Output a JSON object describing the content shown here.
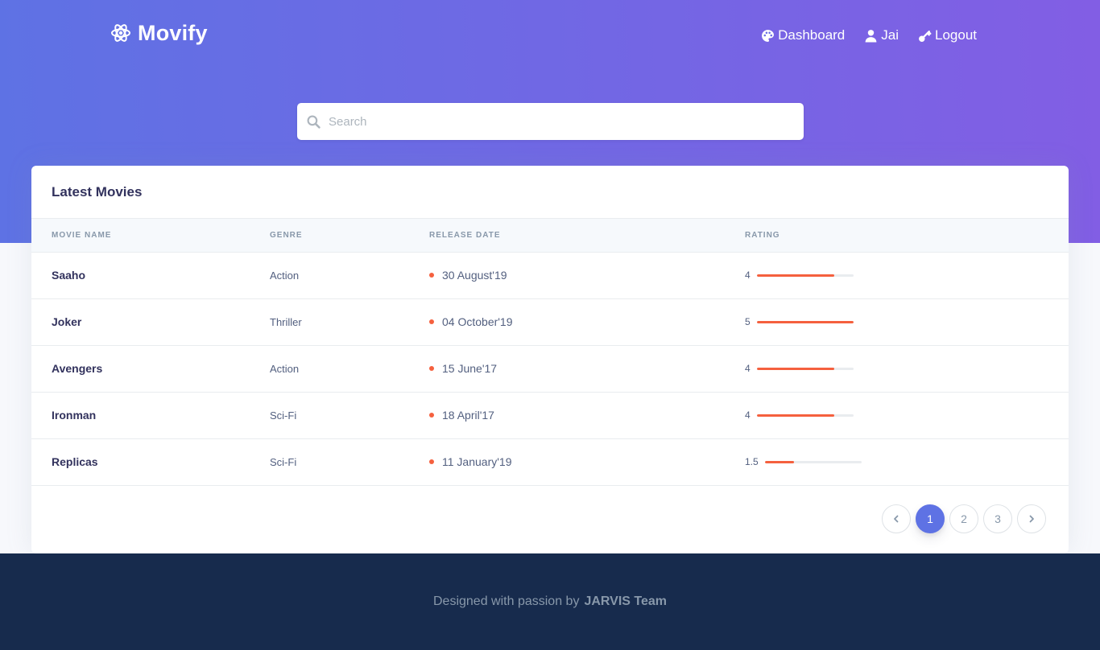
{
  "brand": {
    "name": "Movify",
    "icon": "atom-icon"
  },
  "nav": {
    "items": [
      {
        "label": "Dashboard",
        "icon": "palette-icon"
      },
      {
        "label": "Jai",
        "icon": "user-icon"
      },
      {
        "label": "Logout",
        "icon": "key-icon"
      }
    ]
  },
  "search": {
    "placeholder": "Search",
    "value": ""
  },
  "card": {
    "title": "Latest Movies",
    "columns": [
      "Movie Name",
      "Genre",
      "Release Date",
      "Rating"
    ],
    "rows": [
      {
        "name": "Saaho",
        "genre": "Action",
        "release_date": "30 August'19",
        "rating": "4",
        "rating_fraction": 0.8
      },
      {
        "name": "Joker",
        "genre": "Thriller",
        "release_date": "04 October'19",
        "rating": "5",
        "rating_fraction": 1.0
      },
      {
        "name": "Avengers",
        "genre": "Action",
        "release_date": "15 June'17",
        "rating": "4",
        "rating_fraction": 0.8
      },
      {
        "name": "Ironman",
        "genre": "Sci-Fi",
        "release_date": "18 April'17",
        "rating": "4",
        "rating_fraction": 0.8
      },
      {
        "name": "Replicas",
        "genre": "Sci-Fi",
        "release_date": "11 January'19",
        "rating": "1.5",
        "rating_fraction": 0.3
      }
    ]
  },
  "pagination": {
    "pages": [
      "1",
      "2",
      "3"
    ],
    "active": "1"
  },
  "footer": {
    "text": "Designed with passion by",
    "team": "JARVIS Team"
  },
  "colors": {
    "gradient_start": "#5e72e4",
    "gradient_end": "#825ee4",
    "accent": "#f5603e",
    "footer_bg": "#172b4d"
  }
}
